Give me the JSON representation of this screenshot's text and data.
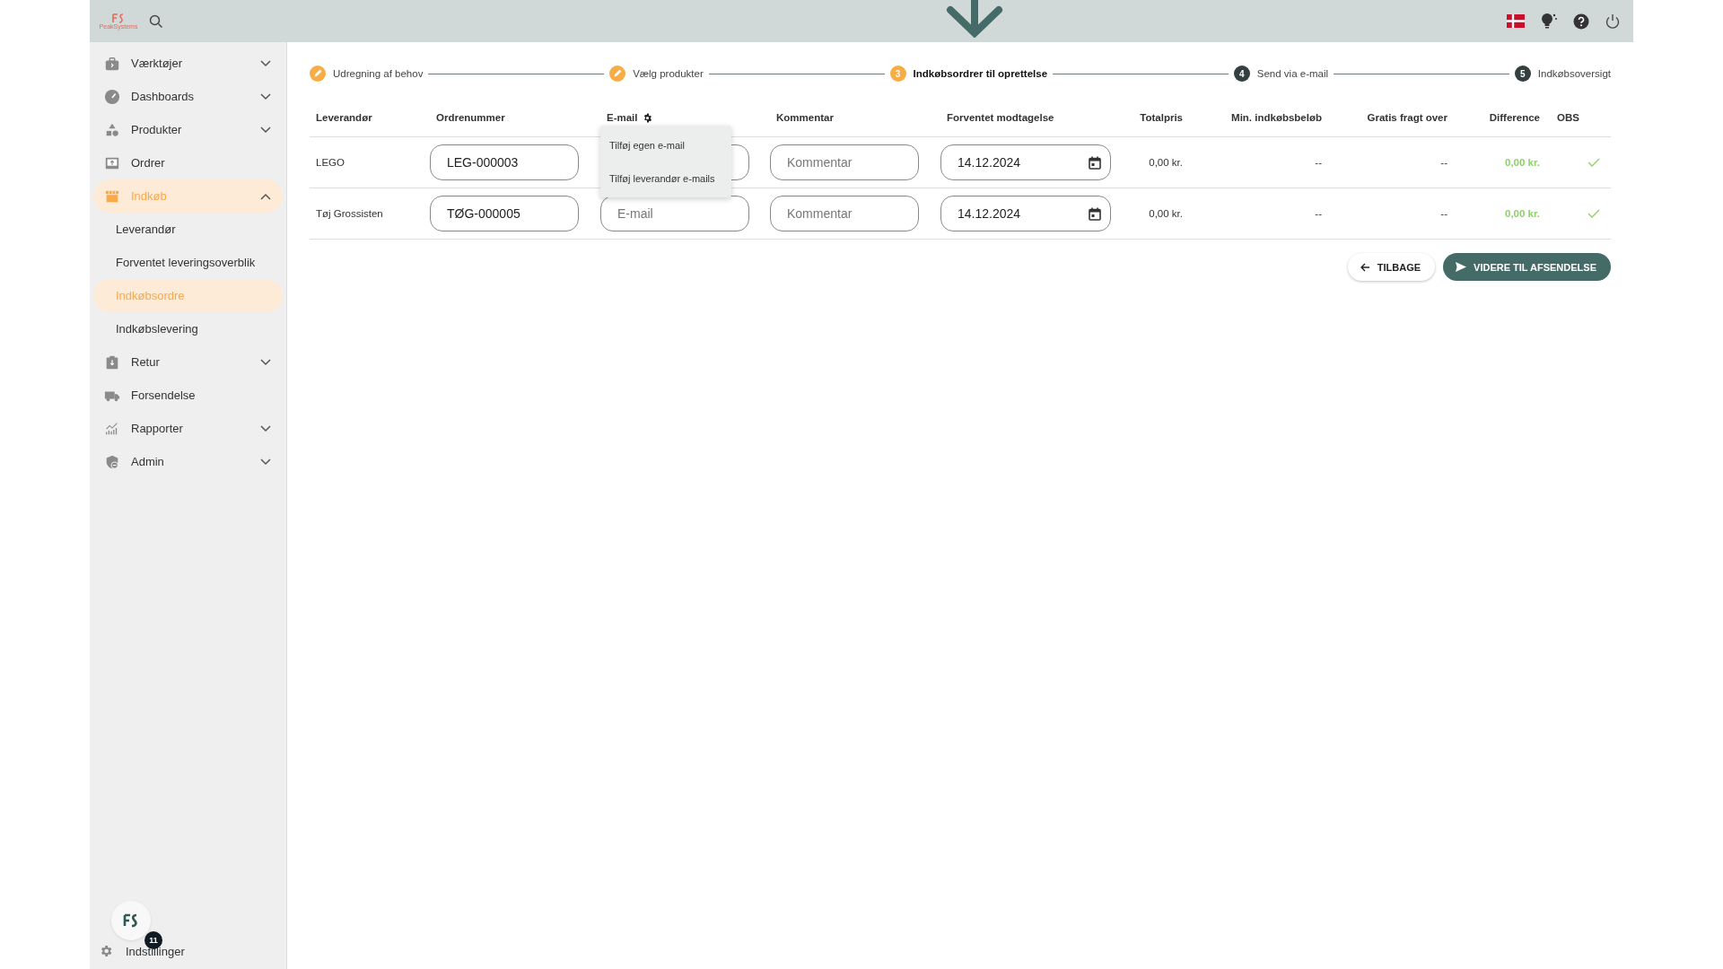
{
  "topbar": {
    "logo_text": "PeakSystems"
  },
  "sidebar": {
    "items": [
      {
        "label": "Værktøjer",
        "expanded": false,
        "selected": false
      },
      {
        "label": "Dashboards",
        "expanded": false,
        "selected": false
      },
      {
        "label": "Produkter",
        "expanded": false,
        "selected": false
      },
      {
        "label": "Ordrer",
        "selected": false
      },
      {
        "label": "Indkøb",
        "expanded": true,
        "selected": true,
        "children": [
          {
            "label": "Leverandør",
            "selected": false
          },
          {
            "label": "Forventet leveringsoverblik",
            "selected": false
          },
          {
            "label": "Indkøbsordre",
            "selected": true
          },
          {
            "label": "Indkøbslevering",
            "selected": false
          }
        ]
      },
      {
        "label": "Retur",
        "expanded": false,
        "selected": false
      },
      {
        "label": "Forsendelse",
        "selected": false
      },
      {
        "label": "Rapporter",
        "expanded": false,
        "selected": false
      },
      {
        "label": "Admin",
        "expanded": false,
        "selected": false
      }
    ],
    "badge": "11",
    "settings": "Indstillinger"
  },
  "stepper": [
    {
      "label": "Udregning af behov",
      "done": true,
      "selected": false
    },
    {
      "label": "Vælg produkter",
      "done": true,
      "selected": false
    },
    {
      "number": "3",
      "label": "Indkøbsordrer til oprettelse",
      "done": false,
      "selected": true
    },
    {
      "number": "4",
      "label": "Send via e-mail",
      "done": false,
      "selected": false
    },
    {
      "number": "5",
      "label": "Indkøbsoversigt",
      "done": false,
      "selected": false
    }
  ],
  "table": {
    "columns": [
      "Leverandør",
      "Ordrenummer",
      "E-mail",
      "Kommentar",
      "Forventet modtagelse",
      "Totalpris",
      "Min. indkøbsbeløb",
      "Gratis fragt over",
      "Difference",
      "OBS"
    ],
    "rows": [
      {
        "supplier": "LEGO",
        "order_number": "LEG-000003",
        "comment_placeholder": "Kommentar",
        "date": "14.12.2024",
        "total": "0,00 kr.",
        "min": "--",
        "free_shipping": "--",
        "difference": "0,00 kr.",
        "obs_ok": true
      },
      {
        "supplier": "Tøj Grossisten",
        "order_number": "TØG-000005",
        "email_placeholder": "E-mail",
        "comment_placeholder": "Kommentar",
        "date": "14.12.2024",
        "total": "0,00 kr.",
        "min": "--",
        "free_shipping": "--",
        "difference": "0,00 kr.",
        "obs_ok": true
      }
    ]
  },
  "email_menu": [
    "Tilføj egen e-mail",
    "Tilføj leverandør e-mails"
  ],
  "buttons": [
    {
      "label": "TILBAGE",
      "kind": "secondary"
    },
    {
      "label": "VIDERE TIL AFSENDELSE",
      "kind": "primary"
    }
  ]
}
